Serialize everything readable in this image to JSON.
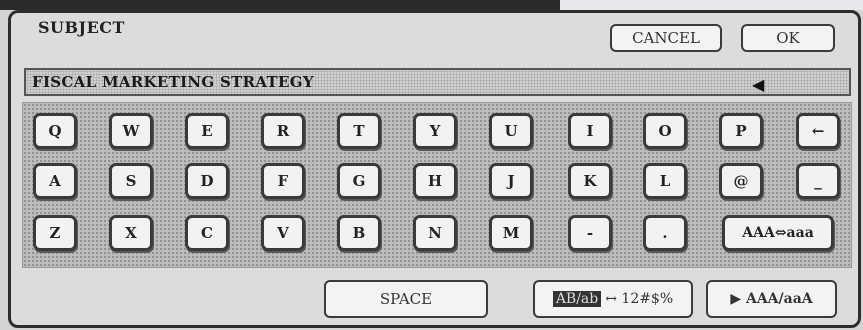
{
  "title": "SUBJECT",
  "buttons": {
    "cancel": "CANCEL",
    "ok": "OK"
  },
  "input": {
    "value": "FISCAL MARKETING STRATEGY",
    "cursor_glyph": "◀"
  },
  "rows": [
    [
      "Q",
      "W",
      "E",
      "R",
      "T",
      "Y",
      "U",
      "I",
      "O",
      "P",
      "←"
    ],
    [
      "A",
      "S",
      "D",
      "F",
      "G",
      "H",
      "J",
      "K",
      "L",
      "@",
      "_"
    ],
    [
      "Z",
      "X",
      "C",
      "V",
      "B",
      "N",
      "M",
      "-",
      ".",
      "AAA⇔aaa"
    ]
  ],
  "bottom": {
    "space": "SPACE",
    "mode_toggle_active": "AB/ab",
    "mode_toggle_rest": "↔ 12#$%",
    "case_mode": "▶ AAA/aaA"
  }
}
